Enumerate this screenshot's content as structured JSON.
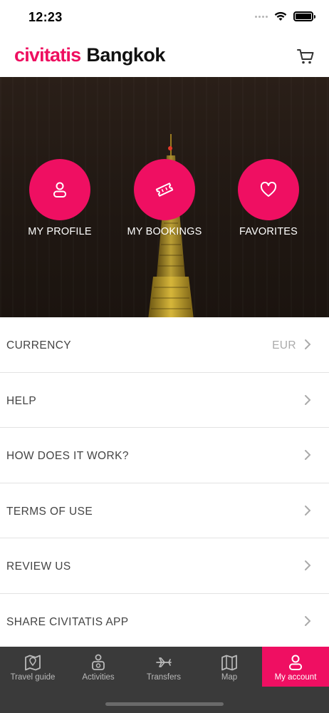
{
  "status_bar": {
    "time": "12:23"
  },
  "header": {
    "brand": "civitatis",
    "city": "Bangkok"
  },
  "hero_actions": [
    {
      "label": "MY PROFILE",
      "icon": "person-icon"
    },
    {
      "label": "MY BOOKINGS",
      "icon": "ticket-icon"
    },
    {
      "label": "FAVORITES",
      "icon": "heart-icon"
    }
  ],
  "menu": [
    {
      "label": "CURRENCY",
      "value": "EUR"
    },
    {
      "label": "HELP"
    },
    {
      "label": "HOW DOES IT WORK?"
    },
    {
      "label": "TERMS OF USE"
    },
    {
      "label": "REVIEW US"
    },
    {
      "label": "SHARE CIVITATIS APP"
    }
  ],
  "tabs": [
    {
      "label": "Travel guide",
      "icon": "map-pin-book-icon"
    },
    {
      "label": "Activities",
      "icon": "tourist-icon"
    },
    {
      "label": "Transfers",
      "icon": "plane-icon"
    },
    {
      "label": "Map",
      "icon": "map-icon"
    },
    {
      "label": "My account",
      "icon": "person-icon",
      "active": true
    }
  ],
  "colors": {
    "accent": "#ef0f62",
    "tabbar": "#3a3a3a",
    "divider": "#e3e3e3"
  }
}
